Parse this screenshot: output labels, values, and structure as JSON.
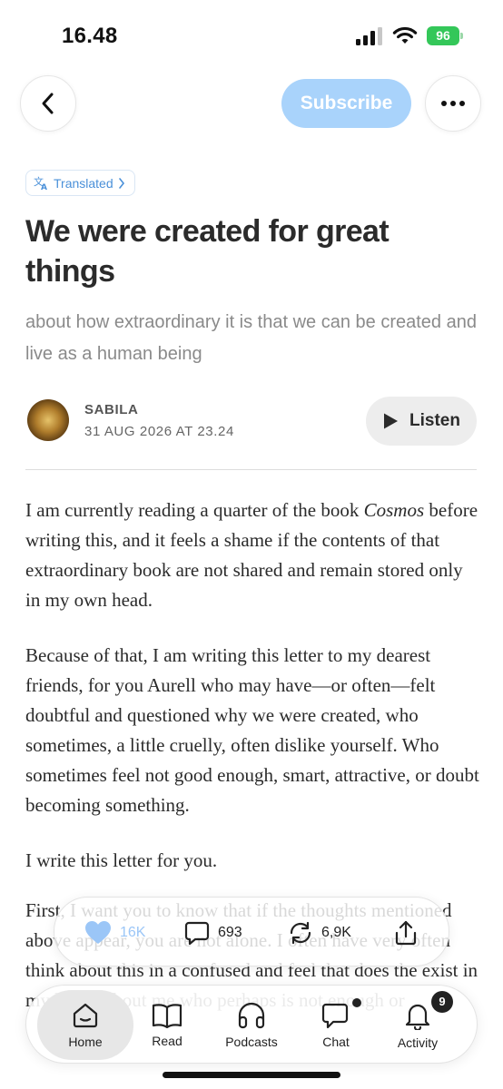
{
  "status_bar": {
    "time": "16.48",
    "battery_level": "96"
  },
  "nav": {
    "subscribe_label": "Subscribe"
  },
  "article": {
    "translated_label": "Translated",
    "title": "We were created for great things",
    "subtitle": "about how extraordinary it is that we can be created and live as a human being",
    "author": "SABILA",
    "date": "31 AUG 2026 AT 23.24",
    "listen_label": "Listen",
    "paragraphs": {
      "p1_before": "I am currently reading a quarter of the book ",
      "p1_italic": "Cosmos",
      "p1_after": " before writing this, and it feels a shame if the contents of that extraordinary book are not shared and remain stored only in my own head.",
      "p2": "Because of that, I am writing this letter to my dearest friends, for you Aurell who may have—or often—felt doubtful and questioned why we were created, who sometimes, a little cruelly, often dislike yourself. Who sometimes feel not good enough, smart, attractive, or doubt becoming something.",
      "p3": "I write this letter for you.",
      "p4": "First, I want you to know that if the thoughts mentioned above appear, you are not alone. I often have very often think about this in a confused and feel that does the exist in my head. About me who perhaps is not enough or"
    }
  },
  "actions": {
    "likes": "16K",
    "comments": "693",
    "restacks": "6,9K"
  },
  "tabs": {
    "home": "Home",
    "read": "Read",
    "podcasts": "Podcasts",
    "chat": "Chat",
    "activity": "Activity",
    "activity_badge": "9"
  }
}
